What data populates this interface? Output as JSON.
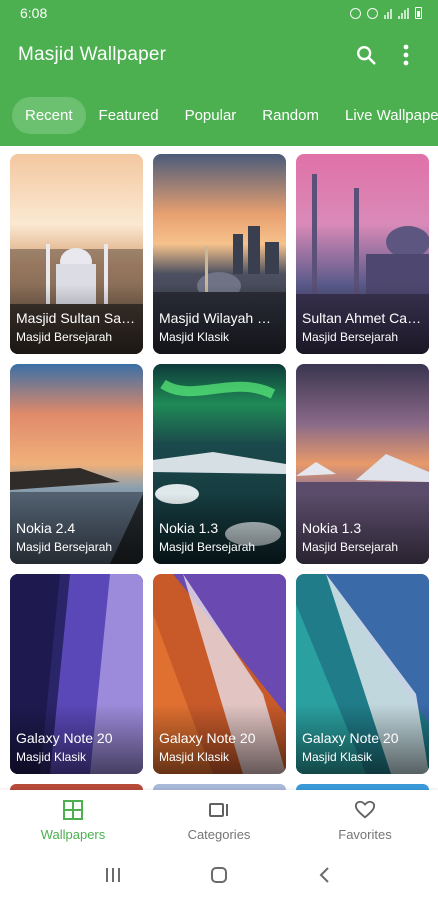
{
  "status_bar": {
    "time": "6:08"
  },
  "app_bar": {
    "title": "Masjid Wallpaper",
    "search_icon": "search-icon",
    "more_icon": "more-vert-icon"
  },
  "tabs": [
    {
      "label": "Recent",
      "active": true
    },
    {
      "label": "Featured",
      "active": false
    },
    {
      "label": "Popular",
      "active": false
    },
    {
      "label": "Random",
      "active": false
    },
    {
      "label": "Live Wallpaper",
      "active": false
    }
  ],
  "wallpapers": [
    {
      "title": "Masjid Sultan Salahuddin",
      "category": "Masjid Bersejarah"
    },
    {
      "title": "Masjid Wilayah Persekutuan",
      "category": "Masjid Klasik"
    },
    {
      "title": "Sultan Ahmet Camii",
      "category": "Masjid Bersejarah"
    },
    {
      "title": "Nokia 2.4",
      "category": "Masjid Bersejarah"
    },
    {
      "title": "Nokia 1.3",
      "category": "Masjid Bersejarah"
    },
    {
      "title": "Nokia 1.3",
      "category": "Masjid Bersejarah"
    },
    {
      "title": "Galaxy Note 20",
      "category": "Masjid Klasik"
    },
    {
      "title": "Galaxy Note 20",
      "category": "Masjid Klasik"
    },
    {
      "title": "Galaxy Note 20",
      "category": "Masjid Klasik"
    }
  ],
  "bottom_nav": [
    {
      "label": "Wallpapers",
      "icon": "grid-icon",
      "active": true
    },
    {
      "label": "Categories",
      "icon": "categories-icon",
      "active": false
    },
    {
      "label": "Favorites",
      "icon": "heart-icon",
      "active": false
    }
  ],
  "colors": {
    "primary": "#4caf50",
    "tab_active_bg": "#6cc170",
    "nav_inactive": "#757575"
  }
}
